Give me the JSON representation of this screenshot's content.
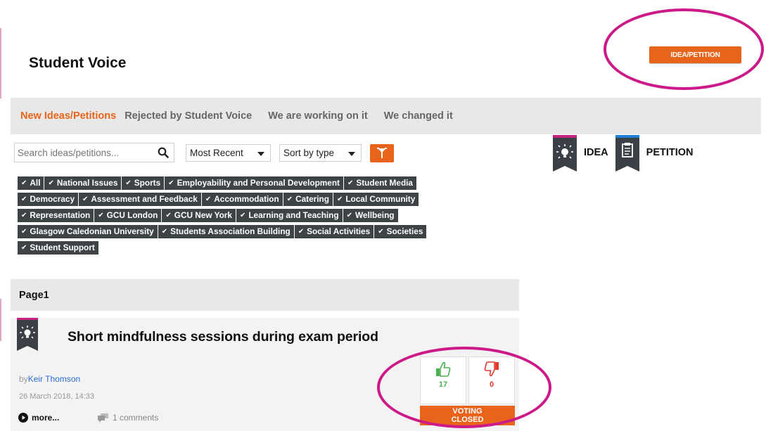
{
  "header": {
    "title": "Student Voice",
    "cta_label": "IDEA/PETITION"
  },
  "tabs": [
    {
      "label": "New Ideas/Petitions",
      "active": true
    },
    {
      "label": "Rejected by Student Voice",
      "active": false
    },
    {
      "label": "We are working on it",
      "active": false
    },
    {
      "label": "We changed it",
      "active": false
    }
  ],
  "toolbar": {
    "search_placeholder": "Search ideas/petitions...",
    "sort_value": "Most Recent",
    "type_value": "Sort by type"
  },
  "categories": [
    [
      "All",
      "National Issues",
      "Sports",
      "Employability and Personal Development",
      "Student Media"
    ],
    [
      "Democracy",
      "Assessment and Feedback",
      "Accommodation",
      "Catering",
      "Local Community"
    ],
    [
      "Representation",
      "GCU London",
      "GCU New York",
      "Learning and Teaching",
      "Wellbeing"
    ],
    [
      "Glasgow Caledonian University",
      "Students Association Building",
      "Social Activities",
      "Societies"
    ],
    [
      "Student Support"
    ]
  ],
  "legend": {
    "idea_label": "IDEA",
    "petition_label": "PETITION",
    "idea_color": "#c6257f",
    "petition_color": "#1f7fd4"
  },
  "list": {
    "page_label": "Page1"
  },
  "post": {
    "title": "Short mindfulness sessions during exam period",
    "by_prefix": "by",
    "author": "Keir Thomson",
    "date": "26 March 2018, 14:33",
    "more_label": "more...",
    "comments_label": "1 comments",
    "upvotes": "17",
    "downvotes": "0",
    "status_line1": "VOTING",
    "status_line2": "CLOSED"
  },
  "colors": {
    "accent": "#e8641b",
    "chip_bg": "#3e4346",
    "highlight": "#cc1a88"
  }
}
